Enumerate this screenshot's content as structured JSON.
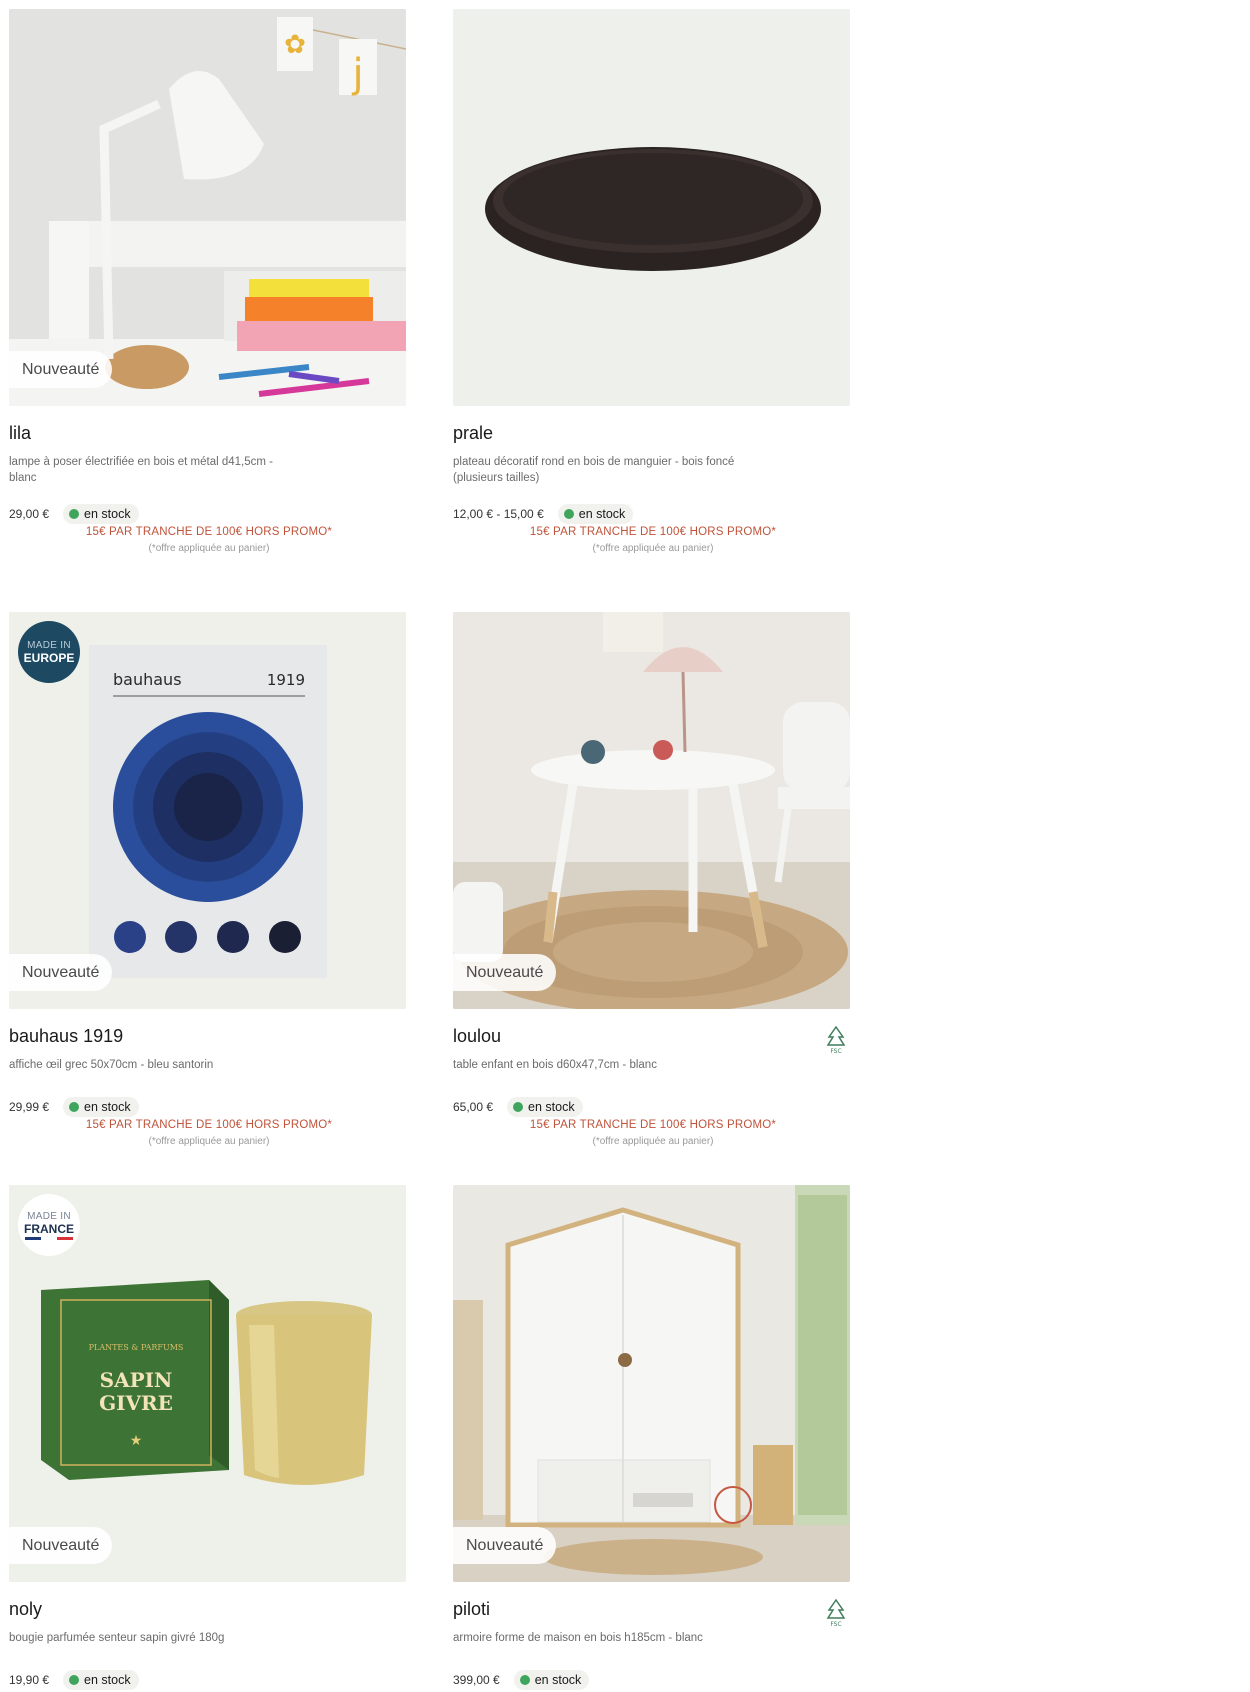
{
  "products": [
    {
      "name": "lila",
      "description": "lampe à poser électrifiée en bois et métal d41,5cm - blanc",
      "price": "29,00 €",
      "stock": "en stock",
      "badge": "Nouveauté",
      "promo": "15€ PAR TRANCHE DE 100€ HORS PROMO*",
      "promo_note": "(*offre appliquée au panier)"
    },
    {
      "name": "prale",
      "description": "plateau décoratif rond en bois de manguier - bois foncé (plusieurs tailles)",
      "price": "12,00 € - 15,00 €",
      "stock": "en stock",
      "badge": "",
      "promo": "15€ PAR TRANCHE DE 100€ HORS PROMO*",
      "promo_note": "(*offre appliquée au panier)"
    },
    {
      "name": "bauhaus 1919",
      "description": "affiche œil grec 50x70cm - bleu santorin",
      "price": "29,99 €",
      "stock": "en stock",
      "badge": "Nouveauté",
      "made_in": {
        "line1": "MADE IN",
        "line2": "EUROPE"
      },
      "poster": {
        "brand": "bauhaus",
        "year": "1919"
      },
      "promo": "15€ PAR TRANCHE DE 100€ HORS PROMO*",
      "promo_note": "(*offre appliquée au panier)"
    },
    {
      "name": "loulou",
      "description": "table enfant en bois d60x47,7cm - blanc",
      "price": "65,00 €",
      "stock": "en stock",
      "badge": "Nouveauté",
      "label": "FSC",
      "promo": "15€ PAR TRANCHE DE 100€ HORS PROMO*",
      "promo_note": "(*offre appliquée au panier)"
    },
    {
      "name": "noly",
      "description": "bougie parfumée senteur sapin givré 180g",
      "price": "19,90 €",
      "stock": "en stock",
      "badge": "Nouveauté",
      "made_in": {
        "line1": "MADE IN",
        "line2": "FRANCE"
      },
      "box_text": {
        "brand": "PLANTES & PARFUMS",
        "scent_line1": "SAPIN",
        "scent_line2": "GIVRE"
      }
    },
    {
      "name": "piloti",
      "description": "armoire forme de maison en bois h185cm - blanc",
      "price": "399,00 €",
      "stock": "en stock",
      "badge": "Nouveauté",
      "label": "FSC"
    }
  ],
  "colors": {
    "stock_dot": "#3fa55d",
    "promo_text": "#c0533a",
    "europe_badge": "#1d4a62"
  }
}
